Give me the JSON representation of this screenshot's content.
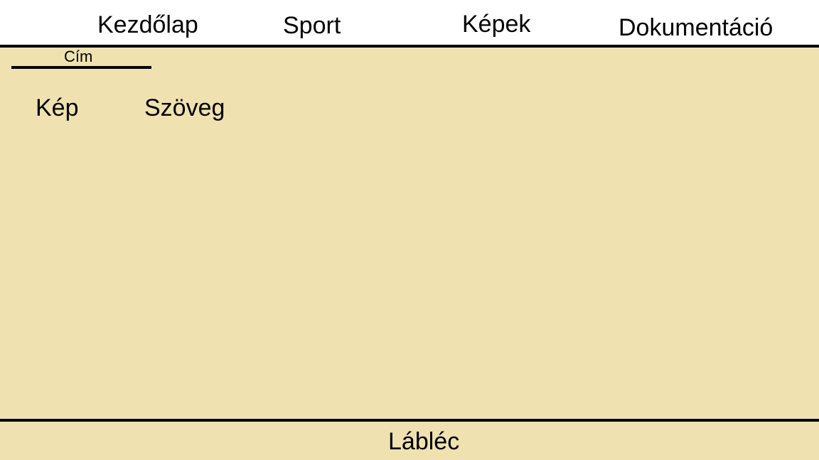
{
  "nav": {
    "items": [
      {
        "label": "Kezdőlap"
      },
      {
        "label": "Sport"
      },
      {
        "label": "Képek"
      },
      {
        "label": "Dokumentáció"
      }
    ]
  },
  "content": {
    "title_label": "Cím",
    "image_label": "Kép",
    "text_label": "Szöveg"
  },
  "footer": {
    "label": "Lábléc"
  },
  "colors": {
    "content_background": "#efe2b0",
    "header_background": "#ffffff",
    "divider": "#000000"
  }
}
